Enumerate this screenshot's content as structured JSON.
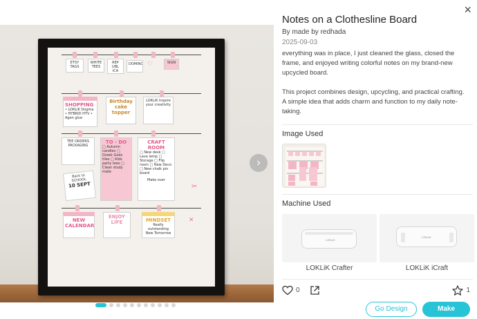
{
  "project": {
    "title": "Notes on a Clothesline Board",
    "author": "By made by redhada",
    "date": "2025-09-03",
    "description": [
      "everything was in place, I just cleaned the glass, closed the frame, and enjoyed writing colorful notes on my brand-new upcycled board.",
      "This project combines design, upcycling, and practical crafting. A simple idea that adds charm and function to my daily note-taking."
    ]
  },
  "sections": {
    "image_used": "Image Used",
    "machine_used": "Machine Used"
  },
  "machines": [
    {
      "name": "LOKLiK Crafter",
      "brand": "LOKLiK"
    },
    {
      "name": "LOKLiK iCraft",
      "brand": "LOKLiK"
    }
  ],
  "stats": {
    "likes": "0",
    "favorites": "1"
  },
  "buttons": {
    "go_design": "Go Design",
    "make": "Make"
  },
  "icons": {
    "close": "close-icon",
    "next": "chevron-right-icon",
    "like": "heart-icon",
    "share": "share-icon",
    "favorite": "star-icon"
  },
  "carousel": {
    "total": 11,
    "active": 1
  },
  "photo_notes": {
    "row1": [
      "ETSY TAGS",
      "WHITE TEES",
      "REP UBL ICA",
      "DOMINO",
      "",
      "SIGN"
    ],
    "row2": [
      "SHOPPING",
      "• LOKLiK Dogma • HYBRID HTV • Agen glue",
      "Birthday cake topper",
      "LOKLiK Inspire your creativity"
    ],
    "row3": [
      "TEE ORDERS PACKAGING",
      "TO - DO",
      "□ Autumn candles □ Greek Gods tiles □ Kids party tees □ Clean study mate",
      "CRAFT ROOM",
      "□ New desk □ Lava lamp □ Storage □ Flip room □ New Deco □ New chalk pin board",
      "Make over"
    ],
    "row4": [
      "Back to SCHOOL",
      "10 SEPT"
    ],
    "row5": [
      "NEW CALENDAR",
      "ENJOY LIFE",
      "MINDSET",
      "Really outstanding New Tomorrow"
    ]
  },
  "colors": {
    "accent": "#27c3d6",
    "pink": "#f7c8d4",
    "frame": "#141211"
  }
}
